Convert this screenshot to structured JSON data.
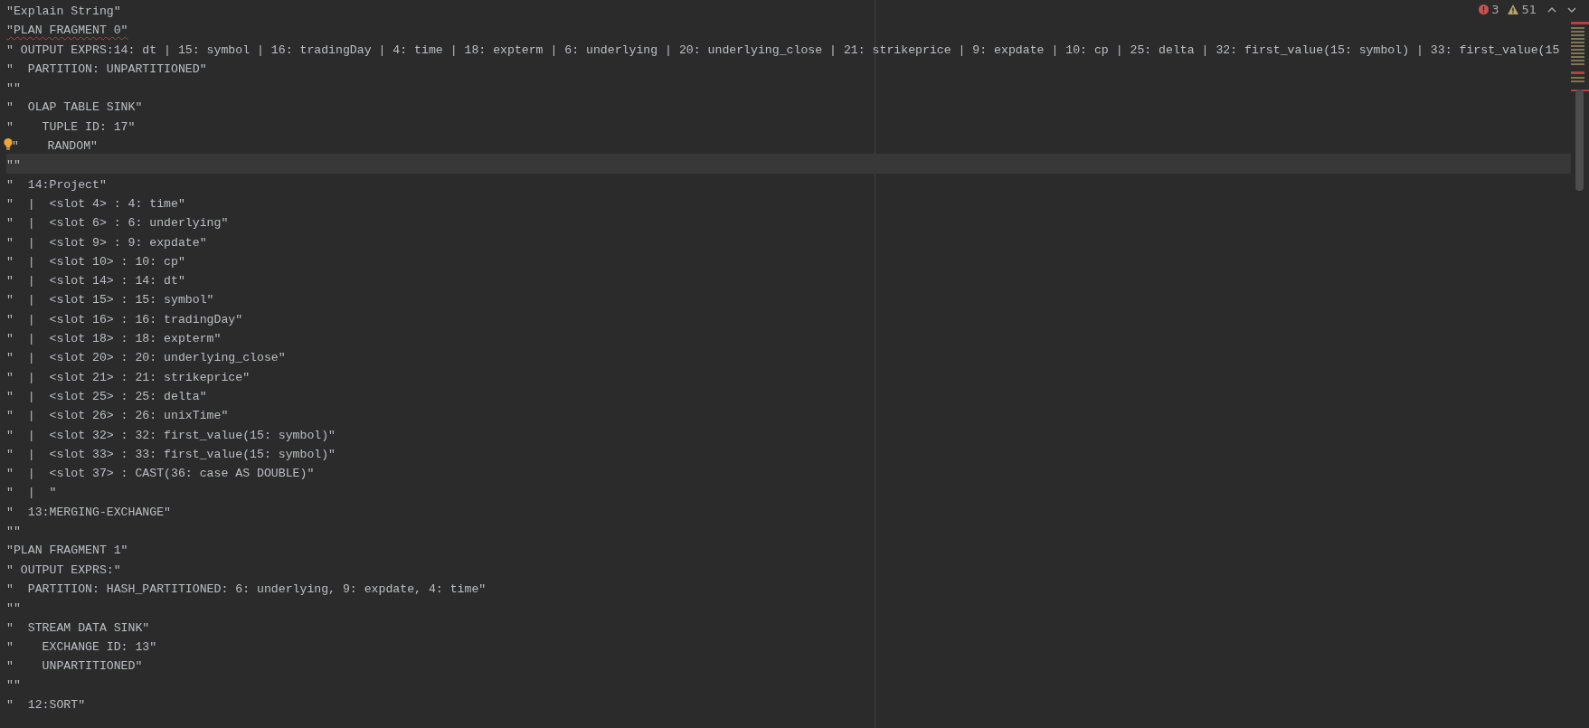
{
  "inspections": {
    "errors": "3",
    "warnings": "51"
  },
  "lines": [
    {
      "text": "\"Explain String\"",
      "squiggle": false,
      "bulb": false,
      "current": false
    },
    {
      "text": "\"PLAN FRAGMENT 0\"",
      "squiggle": true,
      "bulb": false,
      "current": false
    },
    {
      "text": "\" OUTPUT EXPRS:14: dt | 15: symbol | 16: tradingDay | 4: time | 18: expterm | 6: underlying | 20: underlying_close | 21: strikeprice | 9: expdate | 10: cp | 25: delta | 32: first_value(15: symbol) | 33: first_value(15",
      "squiggle": false,
      "bulb": false,
      "current": false
    },
    {
      "text": "\"  PARTITION: UNPARTITIONED\"",
      "squiggle": false,
      "bulb": false,
      "current": false
    },
    {
      "text": "\"\"",
      "squiggle": false,
      "bulb": false,
      "current": false
    },
    {
      "text": "\"  OLAP TABLE SINK\"",
      "squiggle": false,
      "bulb": false,
      "current": false
    },
    {
      "text": "\"    TUPLE ID: 17\"",
      "squiggle": false,
      "bulb": false,
      "current": false
    },
    {
      "text": "\"    RANDOM\"",
      "squiggle": false,
      "bulb": true,
      "current": false
    },
    {
      "text": "\"\"",
      "squiggle": false,
      "bulb": false,
      "current": true
    },
    {
      "text": "\"  14:Project\"",
      "squiggle": false,
      "bulb": false,
      "current": false
    },
    {
      "text": "\"  |  <slot 4> : 4: time\"",
      "squiggle": false,
      "bulb": false,
      "current": false
    },
    {
      "text": "\"  |  <slot 6> : 6: underlying\"",
      "squiggle": false,
      "bulb": false,
      "current": false
    },
    {
      "text": "\"  |  <slot 9> : 9: expdate\"",
      "squiggle": false,
      "bulb": false,
      "current": false
    },
    {
      "text": "\"  |  <slot 10> : 10: cp\"",
      "squiggle": false,
      "bulb": false,
      "current": false
    },
    {
      "text": "\"  |  <slot 14> : 14: dt\"",
      "squiggle": false,
      "bulb": false,
      "current": false
    },
    {
      "text": "\"  |  <slot 15> : 15: symbol\"",
      "squiggle": false,
      "bulb": false,
      "current": false
    },
    {
      "text": "\"  |  <slot 16> : 16: tradingDay\"",
      "squiggle": false,
      "bulb": false,
      "current": false
    },
    {
      "text": "\"  |  <slot 18> : 18: expterm\"",
      "squiggle": false,
      "bulb": false,
      "current": false
    },
    {
      "text": "\"  |  <slot 20> : 20: underlying_close\"",
      "squiggle": false,
      "bulb": false,
      "current": false
    },
    {
      "text": "\"  |  <slot 21> : 21: strikeprice\"",
      "squiggle": false,
      "bulb": false,
      "current": false
    },
    {
      "text": "\"  |  <slot 25> : 25: delta\"",
      "squiggle": false,
      "bulb": false,
      "current": false
    },
    {
      "text": "\"  |  <slot 26> : 26: unixTime\"",
      "squiggle": false,
      "bulb": false,
      "current": false
    },
    {
      "text": "\"  |  <slot 32> : 32: first_value(15: symbol)\"",
      "squiggle": false,
      "bulb": false,
      "current": false
    },
    {
      "text": "\"  |  <slot 33> : 33: first_value(15: symbol)\"",
      "squiggle": false,
      "bulb": false,
      "current": false
    },
    {
      "text": "\"  |  <slot 37> : CAST(36: case AS DOUBLE)\"",
      "squiggle": false,
      "bulb": false,
      "current": false
    },
    {
      "text": "\"  |  \"",
      "squiggle": false,
      "bulb": false,
      "current": false
    },
    {
      "text": "\"  13:MERGING-EXCHANGE\"",
      "squiggle": false,
      "bulb": false,
      "current": false
    },
    {
      "text": "\"\"",
      "squiggle": false,
      "bulb": false,
      "current": false
    },
    {
      "text": "\"PLAN FRAGMENT 1\"",
      "squiggle": false,
      "bulb": false,
      "current": false
    },
    {
      "text": "\" OUTPUT EXPRS:\"",
      "squiggle": false,
      "bulb": false,
      "current": false
    },
    {
      "text": "\"  PARTITION: HASH_PARTITIONED: 6: underlying, 9: expdate, 4: time\"",
      "squiggle": false,
      "bulb": false,
      "current": false
    },
    {
      "text": "\"\"",
      "squiggle": false,
      "bulb": false,
      "current": false
    },
    {
      "text": "\"  STREAM DATA SINK\"",
      "squiggle": false,
      "bulb": false,
      "current": false
    },
    {
      "text": "\"    EXCHANGE ID: 13\"",
      "squiggle": false,
      "bulb": false,
      "current": false
    },
    {
      "text": "\"    UNPARTITIONED\"",
      "squiggle": false,
      "bulb": false,
      "current": false
    },
    {
      "text": "\"\"",
      "squiggle": false,
      "bulb": false,
      "current": false
    },
    {
      "text": "\"  12:SORT\"",
      "squiggle": false,
      "bulb": false,
      "current": false
    }
  ]
}
